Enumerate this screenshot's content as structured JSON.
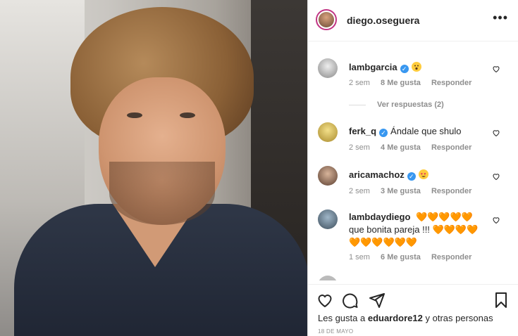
{
  "post": {
    "owner": "diego.oseguera",
    "more_label": "•••",
    "likes_prefix": "Les gusta a",
    "likes_user": "eduardore12",
    "likes_suffix": "y otras personas",
    "date": "18 DE MAYO"
  },
  "comments": [
    {
      "user": "lambgarcia",
      "verified": true,
      "text": "",
      "emoji": "face",
      "time": "2 sem",
      "likes": "8 Me gusta",
      "reply": "Responder"
    },
    {
      "view_replies": "Ver respuestas (2)"
    },
    {
      "user": "ferk_q",
      "verified": true,
      "text": "Ándale que shulo",
      "time": "2 sem",
      "likes": "4 Me gusta",
      "reply": "Responder"
    },
    {
      "user": "aricamachoz",
      "verified": true,
      "text": "",
      "emoji": "heart-eyes",
      "time": "2 sem",
      "likes": "3 Me gusta",
      "reply": "Responder"
    },
    {
      "user": "lambdaydiego",
      "verified": false,
      "hearts_before": "🧡🧡🧡🧡🧡",
      "text": "que bonita pareja !!!",
      "hearts_after": "🧡🧡🧡🧡",
      "hearts_line3": "🧡🧡🧡🧡🧡🧡",
      "time": "1 sem",
      "likes": "6 Me gusta",
      "reply": "Responder"
    }
  ],
  "icons": {
    "like": "heart-icon",
    "comment": "comment-icon",
    "share": "share-icon",
    "save": "bookmark-icon"
  }
}
